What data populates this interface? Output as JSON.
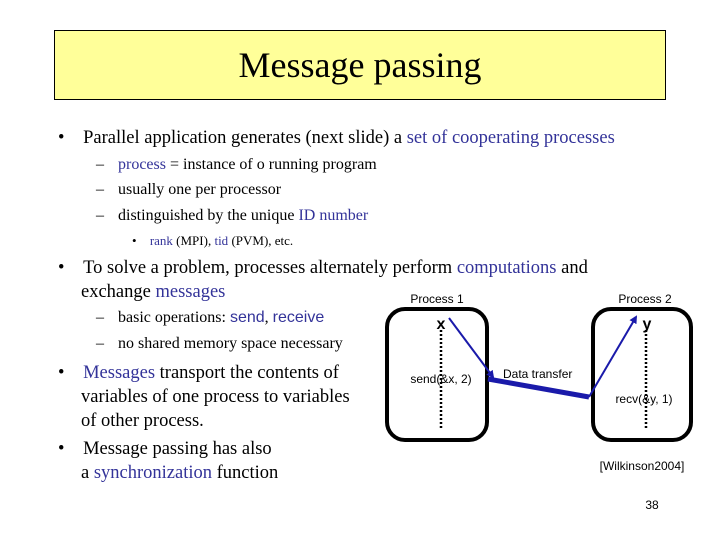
{
  "slide": {
    "title": "Message passing",
    "page_number": "38",
    "citation": "[Wilkinson2004]"
  },
  "bullets": {
    "b1": {
      "bullet": "•",
      "text_a": "Parallel application generates (next slide) a ",
      "hl": "set of cooperating processes"
    },
    "b1_sub": [
      {
        "dash": "–",
        "hl": "process",
        "text": " = instance of o running program"
      },
      {
        "dash": "–",
        "text": "usually one per processor"
      },
      {
        "dash": "–",
        "text": "distinguished by the unique ",
        "hl": "ID number"
      }
    ],
    "b1_subsub": {
      "bullet": "•",
      "hl1": "rank",
      "t1": " (MPI), ",
      "hl2": "tid",
      "t2": " (PVM), etc."
    },
    "b2": {
      "bullet": "•",
      "text_a": "To solve a problem, processes alternately perform ",
      "hl": "computations",
      "text_b": " and",
      "line2_a": "exchange ",
      "line2_hl": "messages"
    },
    "b2_sub": [
      {
        "dash": "–",
        "text": "basic operations: ",
        "hl1": "send",
        "sep": ", ",
        "hl2": "receive"
      },
      {
        "dash": "–",
        "text": "no shared memory space necessary"
      }
    ],
    "b3": {
      "bullet": "•",
      "hl": "Messages",
      "line1": " transport the contents of",
      "line2": "variables of one process to variables",
      "line3": "of other process."
    },
    "b4": {
      "bullet": "•",
      "line1": "Message passing has also",
      "line2_a": "a ",
      "line2_hl": "synchronization",
      "line2_b": " function"
    }
  },
  "diagram": {
    "process1_label": "Process 1",
    "process2_label": "Process 2",
    "var_x": "x",
    "var_y": "y",
    "send_call": "send(&x, 2)",
    "recv_call": "recv(&y, 1)",
    "transfer_label": "Data transfer",
    "arrow_color": "#1a1aaa"
  },
  "colors": {
    "title_bg": "#ffff99",
    "highlight": "#333399"
  }
}
